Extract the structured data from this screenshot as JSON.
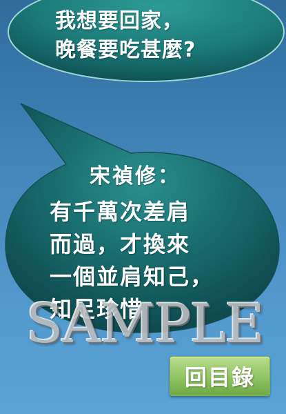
{
  "top_bubble": {
    "lines": [
      "我想要回家，",
      "晚餐要吃甚麼?"
    ]
  },
  "main_bubble": {
    "title": "宋禎修：",
    "lines": [
      "有千萬次差肩",
      "而過，才換來",
      "一個並肩知己，",
      "知足珍惜"
    ]
  },
  "watermark": {
    "text": "SAMPLE"
  },
  "toc_button": {
    "label": "回目錄"
  },
  "colors": {
    "background_top": "#2f6c9c",
    "background_bottom": "#5ba4d7",
    "bubble_dark": "#0c4448",
    "bubble_light": "#2a8f8e",
    "button_green": "#93c766"
  }
}
